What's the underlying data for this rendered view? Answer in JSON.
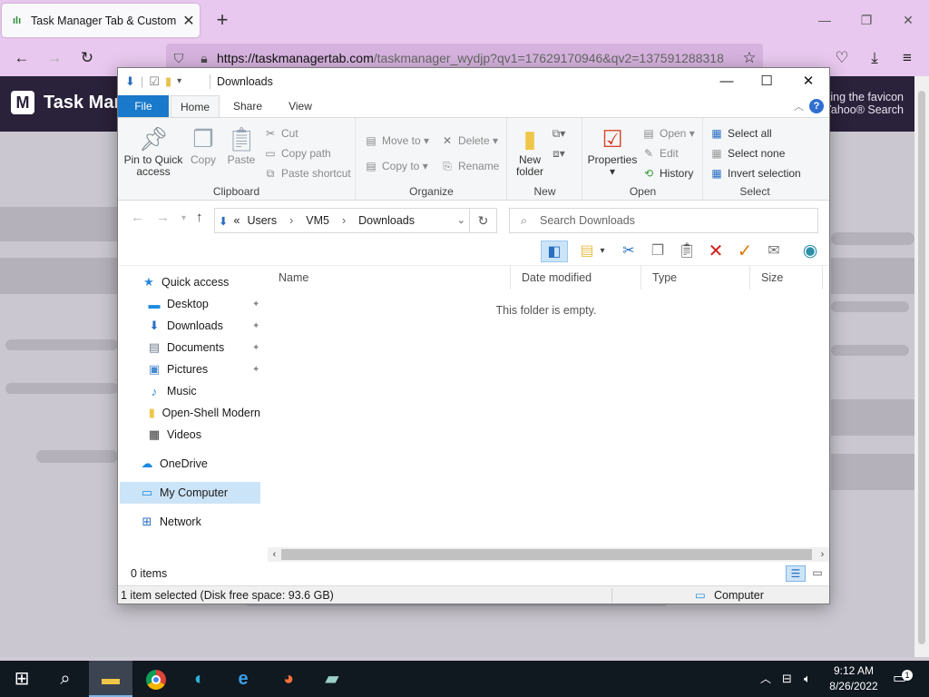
{
  "browser": {
    "tab_title": "Task Manager Tab & Custom W",
    "url_host": "https://taskmanagertab.com",
    "url_rest": "/taskmanager_wydjp?qv1=17629170946&qv2=137591288318"
  },
  "website": {
    "logo_letter": "M",
    "logo_text": "Task Man",
    "header_right_line1": "king the favicon",
    "header_right_line2": "Yahoo® Search"
  },
  "explorer": {
    "title": "Downloads",
    "ribbon_tabs": [
      "File",
      "Home",
      "Share",
      "View"
    ],
    "clipboard": {
      "pin_label_1": "Pin to Quick",
      "pin_label_2": "access",
      "copy": "Copy",
      "paste": "Paste",
      "cut": "Cut",
      "copy_path": "Copy path",
      "paste_shortcut": "Paste shortcut",
      "group": "Clipboard"
    },
    "organize": {
      "move_to": "Move to",
      "copy_to": "Copy to",
      "delete": "Delete",
      "rename": "Rename",
      "group": "Organize"
    },
    "new": {
      "new_folder_1": "New",
      "new_folder_2": "folder",
      "group": "New"
    },
    "open": {
      "properties": "Properties",
      "open": "Open",
      "edit": "Edit",
      "history": "History",
      "group": "Open"
    },
    "select": {
      "select_all": "Select all",
      "select_none": "Select none",
      "invert": "Invert selection",
      "group": "Select"
    },
    "address": {
      "prefix": "«",
      "crumbs": [
        "Users",
        "VM5",
        "Downloads"
      ]
    },
    "search_placeholder": "Search Downloads",
    "nav": {
      "quick_access": "Quick access",
      "desktop": "Desktop",
      "downloads": "Downloads",
      "documents": "Documents",
      "pictures": "Pictures",
      "music": "Music",
      "openshell": "Open-Shell Modern",
      "videos": "Videos",
      "onedrive": "OneDrive",
      "my_computer": "My Computer",
      "network": "Network"
    },
    "columns": [
      "Name",
      "Date modified",
      "Type",
      "Size"
    ],
    "empty_text": "This folder is empty.",
    "items_count": "0 items",
    "status_text": "1 item selected (Disk free space: 93.6 GB)",
    "status_location": "Computer"
  },
  "taskbar": {
    "time": "9:12 AM",
    "date": "8/26/2022",
    "notification_count": "1"
  },
  "colors": {
    "browser_chrome": "#e8c8ee",
    "file_tab": "#1979ca",
    "site_header": "#2a213a",
    "taskbar": "#101820"
  }
}
